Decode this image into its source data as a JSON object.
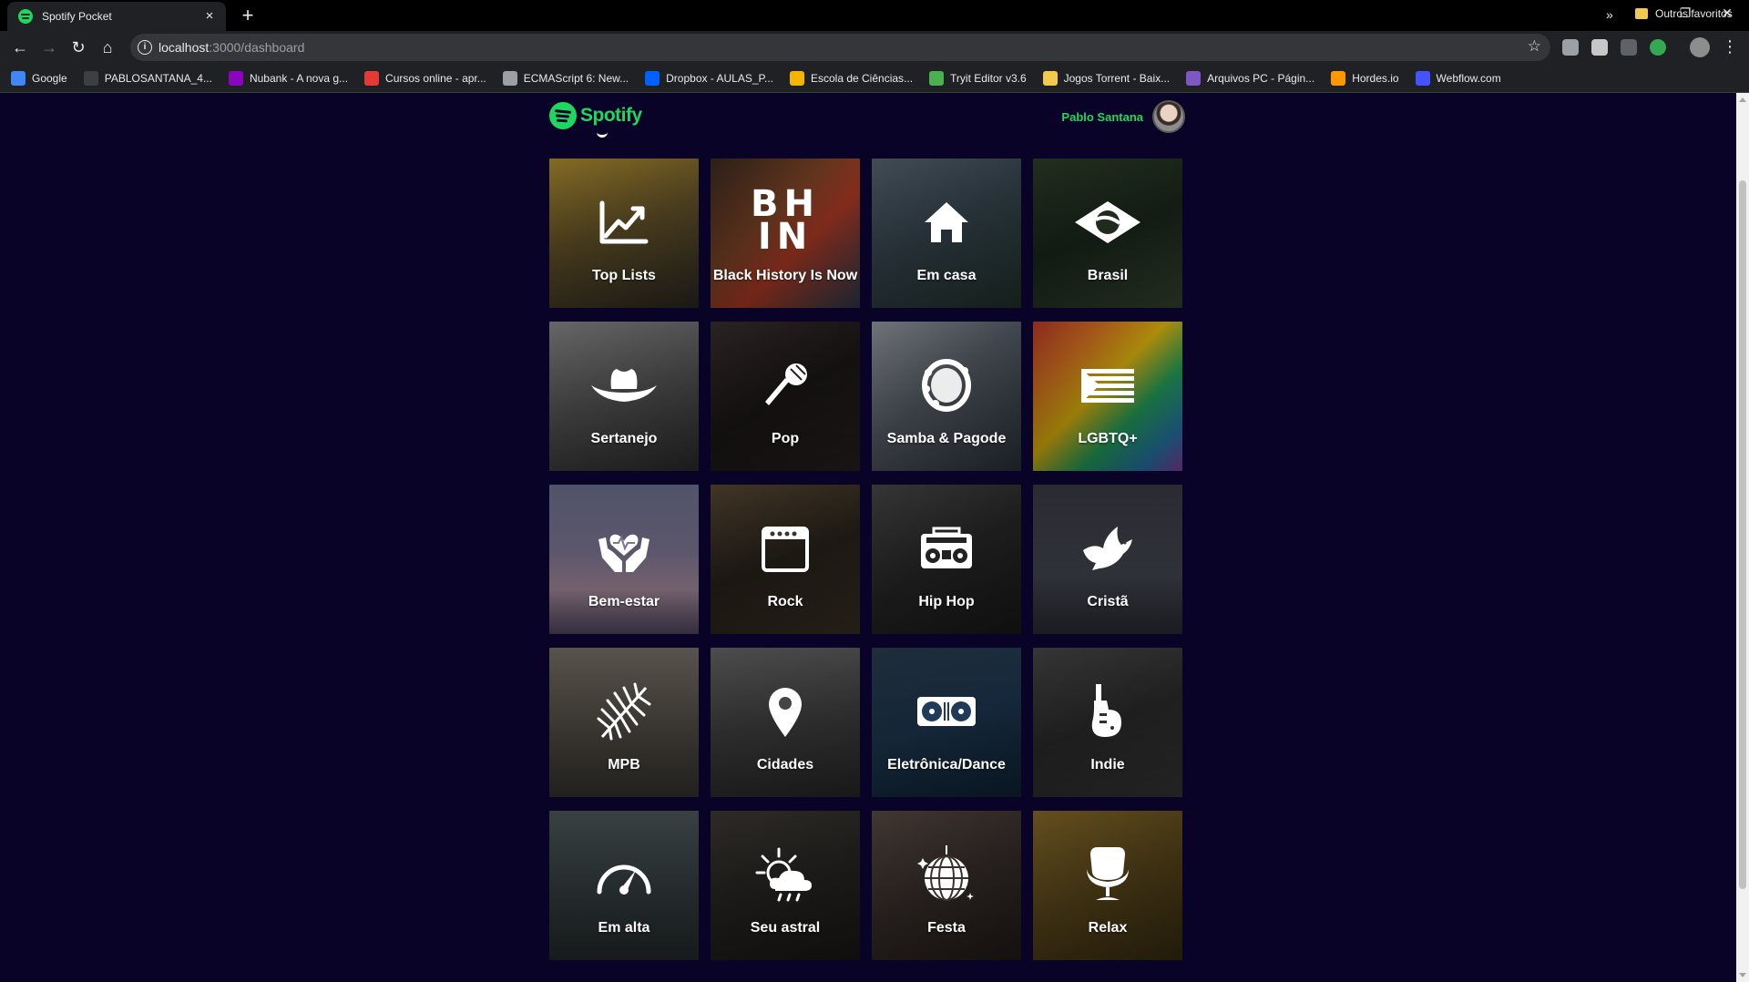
{
  "browser": {
    "tab_title": "Spotify Pocket",
    "tab_close": "×",
    "new_tab": "+",
    "window_controls": [
      "–",
      "❐",
      "✕"
    ],
    "nav": {
      "back": "←",
      "forward": "→",
      "reload": "↻",
      "home": "⌂"
    },
    "url_host": "localhost",
    "url_path": ":3000/dashboard",
    "bookmarks": [
      {
        "label": "Google",
        "color": "#4285f4"
      },
      {
        "label": "PABLOSANTANA_4...",
        "color": "#3c4043"
      },
      {
        "label": "Nubank - A nova g...",
        "color": "#8a05be"
      },
      {
        "label": "Cursos online - apr...",
        "color": "#e53935"
      },
      {
        "label": "ECMAScript 6: New...",
        "color": "#9aa0a6"
      },
      {
        "label": "Dropbox - AULAS_P...",
        "color": "#0061ff"
      },
      {
        "label": "Escola de Ciências...",
        "color": "#f4b400"
      },
      {
        "label": "Tryit Editor v3.6",
        "color": "#4caf50"
      },
      {
        "label": "Jogos Torrent - Baix...",
        "color": "#f2c94c"
      },
      {
        "label": "Arquivos PC - Págin...",
        "color": "#7e57c2"
      },
      {
        "label": "Hordes.io",
        "color": "#ff9800"
      },
      {
        "label": "Webflow.com",
        "color": "#4353ff"
      }
    ],
    "bookmarks_more": "»",
    "other_bookmarks": "Outros favoritos"
  },
  "app": {
    "brand": "Spotify",
    "brand_color": "#1ed760",
    "user_name": "Pablo Santana",
    "background": "#080327"
  },
  "categories": [
    {
      "label": "Top Lists",
      "icon": "trending-up-icon",
      "bg": "linear-gradient(160deg,#b79432 0%,#6e5b2c 45%,#2e2a25 100%)"
    },
    {
      "label": "Black History Is Now",
      "icon": "bhin-logo",
      "bg": "linear-gradient(135deg,#3b2b22 0%,#8a4a2a 40%,#c04028 60%,#2f3e52 100%)"
    },
    {
      "label": "Em casa",
      "icon": "house-icon",
      "bg": "linear-gradient(150deg,#5a6a76 0%,#3b4a55 45%,#23362e 100%)"
    },
    {
      "label": "Brasil",
      "icon": "brazil-flag-icon",
      "bg": "linear-gradient(160deg,#2e3f2a 0%,#1c2a1d 50%,#3a4a35 100%)"
    },
    {
      "label": "Sertanejo",
      "icon": "cowboy-hat-icon",
      "bg": "linear-gradient(160deg,#8e8e8e 0%,#5a5a5a 50%,#2e2e2e 100%)"
    },
    {
      "label": "Pop",
      "icon": "microphone-icon",
      "bg": "linear-gradient(150deg,#3a3030 0%,#1d1818 50%,#2a2222 100%)"
    },
    {
      "label": "Samba & Pagode",
      "icon": "tambourine-icon",
      "bg": "linear-gradient(140deg,#9aa0a8 0%,#5c646e 45%,#2d3440 100%)"
    },
    {
      "label": "LGBTQ+",
      "icon": "pride-flag-icon",
      "bg": "linear-gradient(135deg,#c0392b 0%,#e67e22 25%,#f1c40f 45%,#27ae60 65%,#2980b9 85%,#8e44ad 100%)"
    },
    {
      "label": "Bem-estar",
      "icon": "hands-heart-icon",
      "bg": "linear-gradient(180deg,#6f7391 0%,#8c83a4 45%,#b89cae 70%,#5a4f6a 100%)"
    },
    {
      "label": "Rock",
      "icon": "amplifier-icon",
      "bg": "linear-gradient(160deg,#5a4a35 0%,#2a241c 50%,#3d3326 100%)"
    },
    {
      "label": "Hip Hop",
      "icon": "boombox-icon",
      "bg": "linear-gradient(150deg,#4a4a4a 0%,#2a2a2a 50%,#1a1a1a 100%)"
    },
    {
      "label": "Cristã",
      "icon": "dove-icon",
      "bg": "linear-gradient(180deg,#3a3c45 0%,#4a4d58 60%,#2e3039 100%)"
    },
    {
      "label": "MPB",
      "icon": "palm-leaf-icon",
      "bg": "linear-gradient(180deg,#7a736a 0%,#5b554d 50%,#3b3832 100%)"
    },
    {
      "label": "Cidades",
      "icon": "map-pin-icon",
      "bg": "linear-gradient(170deg,#6a6a6a 0%,#454545 50%,#2a2a2a 100%)"
    },
    {
      "label": "Eletrônica/Dance",
      "icon": "turntables-icon",
      "bg": "linear-gradient(160deg,#2c3e50 0%,#1f3b57 50%,#0f2538 100%)"
    },
    {
      "label": "Indie",
      "icon": "guitar-icon",
      "bg": "linear-gradient(160deg,#4a4a4a 0%,#2e2e2e 50%,#3a3a3a 100%)"
    },
    {
      "label": "Em alta",
      "icon": "speedometer-icon",
      "bg": "linear-gradient(180deg,#4f5a5c 0%,#3a4446 50%,#262d2e 100%)"
    },
    {
      "label": "Seu astral",
      "icon": "weather-sun-cloud-icon",
      "bg": "linear-gradient(160deg,#3e3a36 0%,#2a2724 50%,#1b1917 100%)"
    },
    {
      "label": "Festa",
      "icon": "disco-ball-icon",
      "bg": "linear-gradient(150deg,#5a4c46 0%,#3a302c 50%,#221c1a 100%)"
    },
    {
      "label": "Relax",
      "icon": "armchair-icon",
      "bg": "linear-gradient(150deg,#8a6d2a 0%,#5e4a1c 50%,#3a2e12 100%)"
    }
  ]
}
